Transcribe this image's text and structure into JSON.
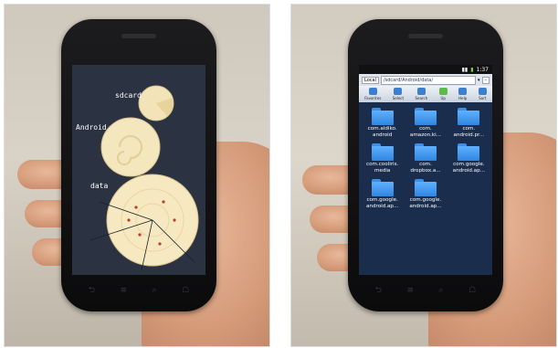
{
  "left_photo": {
    "labels": [
      "sdcard",
      "Android",
      "data"
    ],
    "softkeys": [
      "⮌",
      "≡",
      "⌕",
      "☖"
    ]
  },
  "right_photo": {
    "status_time": "1:37",
    "location_button": "Local",
    "path": "/sdcard/Android/data/",
    "toolbar": [
      "Favorites",
      "Select",
      "Search",
      "Up",
      "Help",
      "Sort"
    ],
    "files": [
      "com.aldiko.\nandroid",
      "com.\namazon.ki...",
      "com.\nandroid.pr...",
      "com.cooliris.\nmedia",
      "com.\ndropbox.a...",
      "com.google.\nandroid.ap...",
      "com.google.\nandroid.ap...",
      "com.google.\nandroid.ap..."
    ],
    "softkeys": [
      "⮌",
      "≡",
      "⌕",
      "☖"
    ]
  }
}
